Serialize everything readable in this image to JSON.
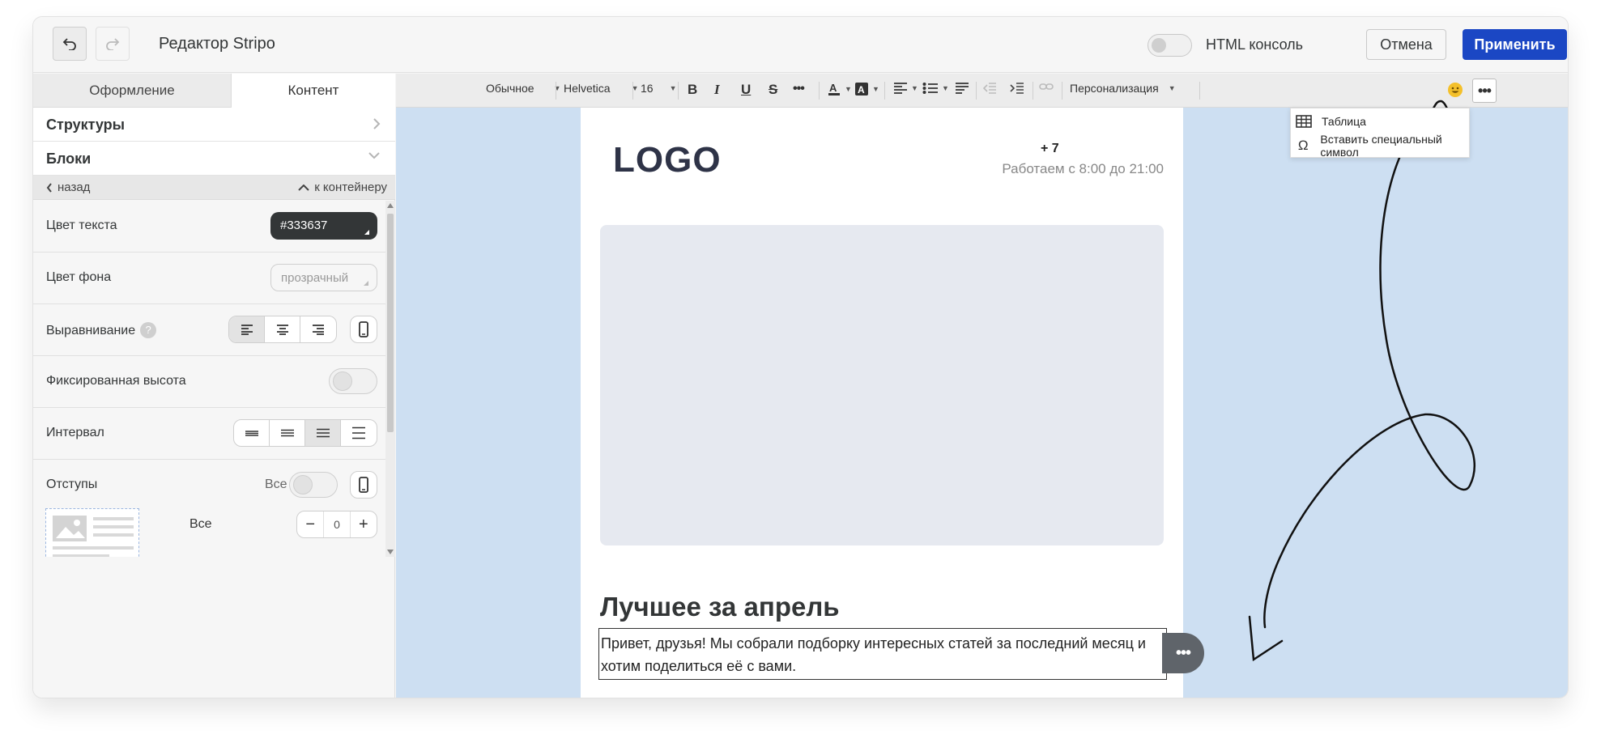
{
  "header": {
    "title": "Редактор Stripo",
    "html_console_label": "HTML консоль",
    "cancel_label": "Отмена",
    "apply_label": "Применить"
  },
  "left_panel": {
    "tabs": [
      {
        "label": "Оформление"
      },
      {
        "label": "Контент"
      }
    ],
    "active_tab": "Контент",
    "sections": [
      {
        "label": "Структуры"
      },
      {
        "label": "Блоки"
      }
    ],
    "back_label": "назад",
    "to_container_label": "к контейнеру",
    "settings": {
      "text_color_label": "Цвет текста",
      "text_color_value": "#333637",
      "bg_color_label": "Цвет фона",
      "bg_color_placeholder": "прозрачный",
      "align_label": "Выравнивание",
      "help_mark": "?",
      "fixed_height_label": "Фиксированная высота",
      "interval_label": "Интервал",
      "padding_label": "Отступы",
      "padding_all_label": "Все",
      "padding_all_row_label": "Все",
      "padding_value": "0"
    }
  },
  "toolbar": {
    "format": "Обычное",
    "font": "Helvetica",
    "size": "16",
    "personalization": "Персонализация"
  },
  "more_menu": {
    "items": [
      {
        "label": "Таблица",
        "icon": "table-icon"
      },
      {
        "label": "Вставить специальный символ",
        "icon": "omega-icon"
      }
    ]
  },
  "email": {
    "logo": "LOGO",
    "phone": "+ 7",
    "hours": "Работаем с 8:00 до 21:00",
    "heading": "Лучшее за апрель",
    "paragraph": "Привет, друзья! Мы собрали подборку интересных статей за последний месяц и хотим поделиться её с вами."
  },
  "colors": {
    "accent": "#1b47c4",
    "canvas_bg": "#cddff2",
    "text_color": "#333637"
  }
}
